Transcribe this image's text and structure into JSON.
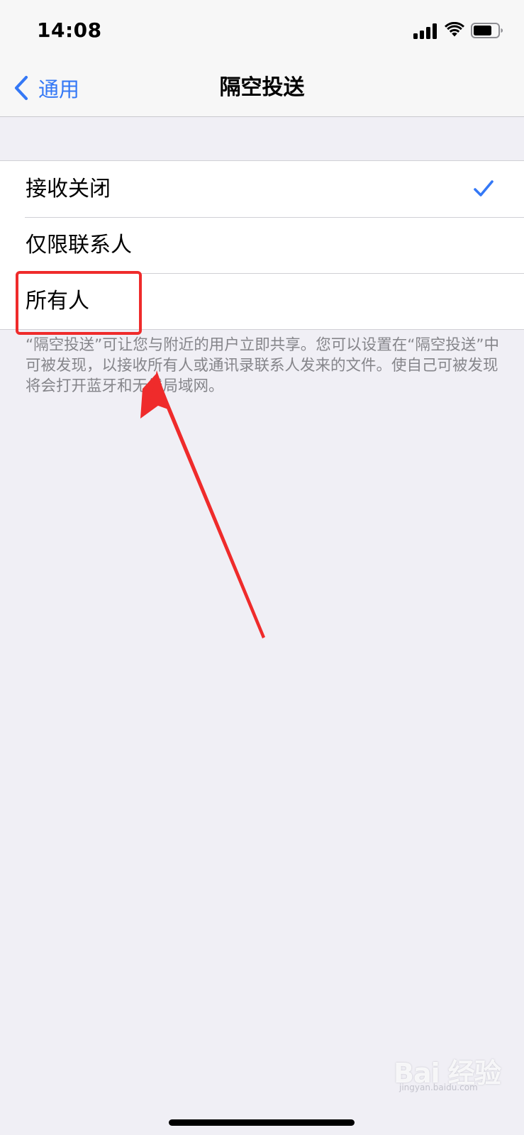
{
  "status_bar": {
    "time": "14:08"
  },
  "nav": {
    "back_label": "通用",
    "title": "隔空投送"
  },
  "options": [
    {
      "label": "接收关闭",
      "selected": true
    },
    {
      "label": "仅限联系人",
      "selected": false
    },
    {
      "label": "所有人",
      "selected": false
    }
  ],
  "footer_note": "“隔空投送”可让您与附近的用户立即共享。您可以设置在“隔空投送”中可被发现，以接收所有人或通讯录联系人发来的文件。使自己可被发现将会打开蓝牙和无线局域网。",
  "watermark": {
    "text": "Bai 经验",
    "sub": "jingyan.baidu.com"
  },
  "colors": {
    "accent": "#3478f6",
    "annotation": "#ef2b2b",
    "background": "#f0eff5"
  },
  "icons": [
    "signal-icon",
    "wifi-icon",
    "battery-icon",
    "chevron-left-icon",
    "checkmark-icon"
  ]
}
